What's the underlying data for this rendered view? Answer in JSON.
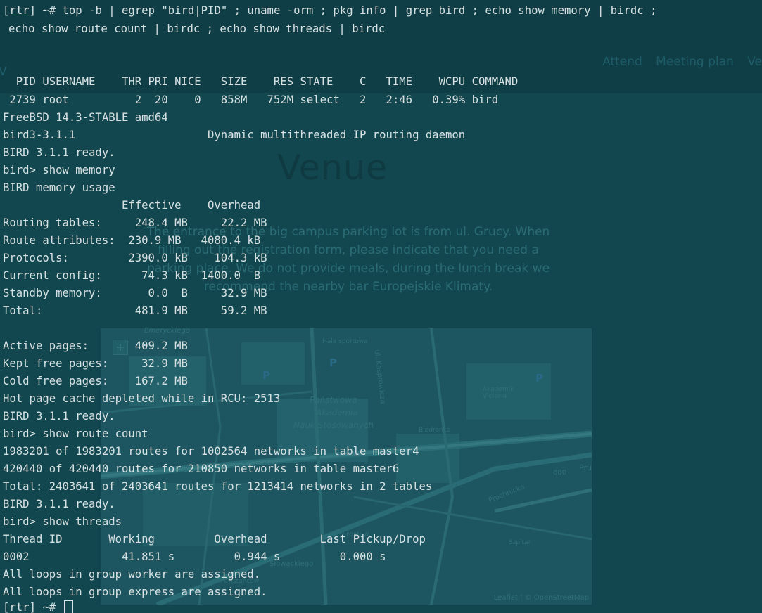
{
  "background_page": {
    "nav": [
      "Attend",
      "Meeting plan",
      "Ve"
    ],
    "left_fragment": "V",
    "title": "Venue",
    "paragraph_lines": [
      "The entrance to the big campus parking lot is from ul. Grucy. When",
      "filling out the registration form, please indicate that you need a",
      "parking place. We do not provide meals, during the lunch break we",
      "recommend the nearby bar Europejskie Klimaty."
    ],
    "map": {
      "zoom_in": "+",
      "labels": [
        "Emeryckiego",
        "Hala sportowa",
        "ul. Kasprowicza",
        "Państwowa",
        "Akademia",
        "Nauk Stosowanych",
        "Akademik Victoria",
        "Prochnicka",
        "Jarosław",
        "Słowackiego",
        "880",
        "Pru",
        "Biedronka",
        "Szpital",
        "Powstańców"
      ],
      "parking_marker": "P",
      "attribution": "Leaflet | © OpenStreetMap"
    }
  },
  "terminal": {
    "prompt_user": "rtr",
    "prompt_suffix": " ~# ",
    "command_line_1": "top -b | egrep \"bird|PID\" ; uname -orm ; pkg info | grep bird ; echo show memory | birdc ;",
    "command_line_2": "echo show route count | birdc ; echo show threads | birdc",
    "lines": [
      "  PID USERNAME    THR PRI NICE   SIZE    RES STATE    C   TIME    WCPU COMMAND",
      " 2739 root          2  20    0   858M   752M select   2   2:46   0.39% bird",
      "FreeBSD 14.3-STABLE amd64",
      "bird3-3.1.1                    Dynamic multithreaded IP routing daemon",
      "BIRD 3.1.1 ready.",
      "bird> show memory",
      "BIRD memory usage",
      "                  Effective    Overhead",
      "Routing tables:     248.4 MB     22.2 MB",
      "Route attributes:  230.9 MB   4080.4 kB",
      "Protocols:         2390.0 kB    104.3 kB",
      "Current config:      74.3 kB  1400.0  B",
      "Standby memory:       0.0  B     32.9 MB",
      "Total:              481.9 MB     59.2 MB",
      "",
      "Active pages:       409.2 MB",
      "Kept free pages:     32.9 MB",
      "Cold free pages:    167.2 MB",
      "Hot page cache depleted while in RCU: 2513",
      "BIRD 3.1.1 ready.",
      "bird> show route count",
      "1983201 of 1983201 routes for 1002564 networks in table master4",
      "420440 of 420440 routes for 210850 networks in table master6",
      "Total: 2403641 of 2403641 routes for 1213414 networks in 2 tables",
      "BIRD 3.1.1 ready.",
      "bird> show threads",
      "Thread ID       Working         Overhead        Last Pickup/Drop",
      "0002              41.851 s         0.944 s         0.000 s",
      "All loops in group worker are assigned.",
      "All loops in group express are assigned."
    ],
    "final_prompt_user": "rtr",
    "final_prompt_suffix": " ~# "
  },
  "colors": {
    "terminal_background": "#13474f",
    "terminal_text": "#d7e1e2",
    "top_band": "#0f3e47"
  }
}
